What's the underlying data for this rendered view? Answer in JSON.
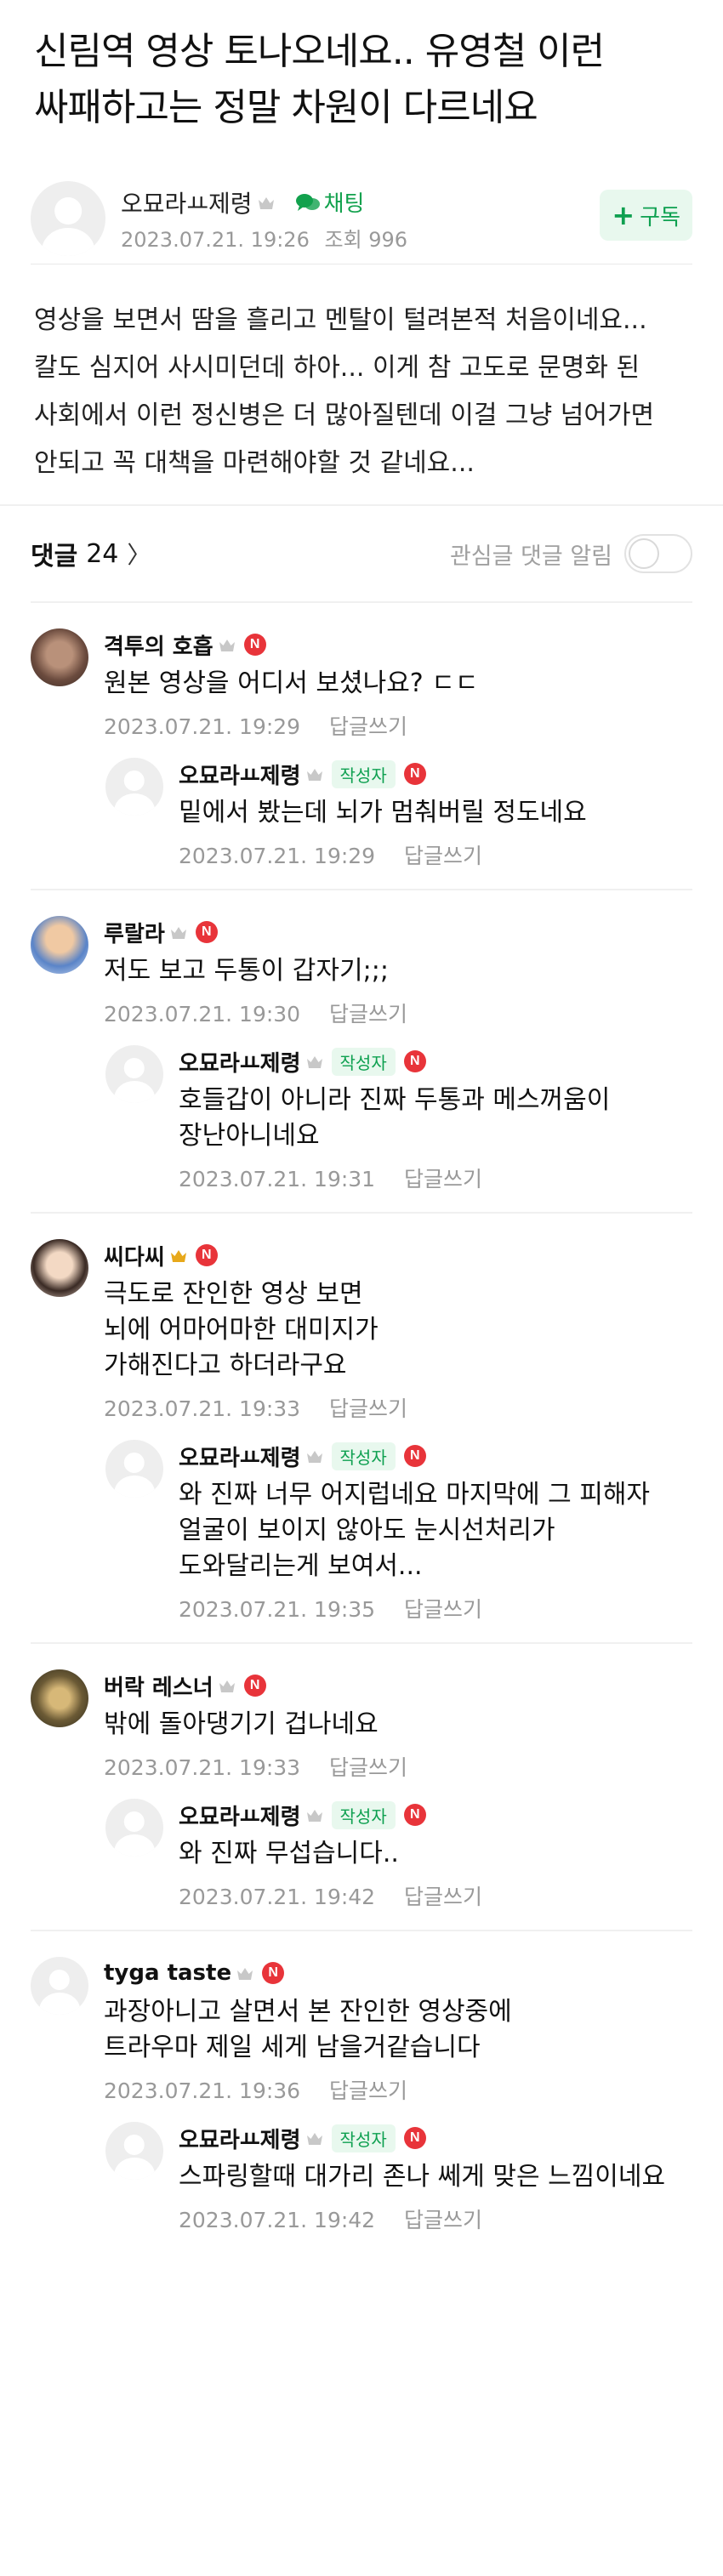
{
  "post": {
    "title": "신림역 영상 토나오네요.. 유영철 이런 싸패하고는 정말 차원이 다르네요",
    "author": "오묘라ㅛ제령",
    "chat_label": "채팅",
    "date": "2023.07.21. 19:26",
    "views": "조회 996",
    "subscribe_label": "구독",
    "body": "영상을 보면서 땀을 흘리고 멘탈이 털려본적 처음이네요... 칼도 심지어 사시미던데 하아... 이게 참 고도로 문명화 된 사회에서 이런 정신병은 더 많아질텐데 이걸 그냥 넘어가면 안되고 꼭 대책을 마련해야할 것 같네요..."
  },
  "comments_header": {
    "label": "댓글",
    "count": "24",
    "notify_label": "관심글 댓글 알림"
  },
  "writer_badge": "작성자",
  "reply_label": "답글쓰기",
  "colors": {
    "accent_green": "#0ea050",
    "badge_red": "#e8343a"
  },
  "comments": [
    {
      "name": "격투의 호흡",
      "text": "원본 영상을 어디서 보셨나요? ㄷㄷ",
      "date": "2023.07.21. 19:29",
      "reply": {
        "name": "오묘라ㅛ제령",
        "text": "밑에서 봤는데 뇌가 멈춰버릴 정도네요",
        "date": "2023.07.21. 19:29"
      }
    },
    {
      "name": "루랄라",
      "text": "저도 보고 두통이 갑자기;;;",
      "date": "2023.07.21. 19:30",
      "reply": {
        "name": "오묘라ㅛ제령",
        "text": "호들갑이 아니라 진짜 두통과 메스꺼움이 장난아니네요",
        "date": "2023.07.21. 19:31"
      }
    },
    {
      "name": "씨다씨",
      "text": "극도로 잔인한 영상 보면\n뇌에 어마어마한 대미지가\n가해진다고 하더라구요",
      "date": "2023.07.21. 19:33",
      "reply": {
        "name": "오묘라ㅛ제령",
        "text": "와 진짜 너무 어지럽네요 마지막에 그 피해자 얼굴이 보이지 않아도 눈시선처리가 도와달리는게 보여서...",
        "date": "2023.07.21. 19:35"
      }
    },
    {
      "name": "버락 레스너",
      "text": "밖에 돌아댕기기 겁나네요",
      "date": "2023.07.21. 19:33",
      "reply": {
        "name": "오묘라ㅛ제령",
        "text": "와 진짜 무섭습니다..",
        "date": "2023.07.21. 19:42"
      }
    },
    {
      "name": "tyga taste",
      "text": "과장아니고 살면서 본 잔인한 영상중에\n트라우마 제일 세게 남을거같습니다",
      "date": "2023.07.21. 19:36",
      "reply": {
        "name": "오묘라ㅛ제령",
        "text": "스파링할때 대가리 존나 쎄게 맞은 느낌이네요",
        "date": "2023.07.21. 19:42"
      }
    }
  ]
}
